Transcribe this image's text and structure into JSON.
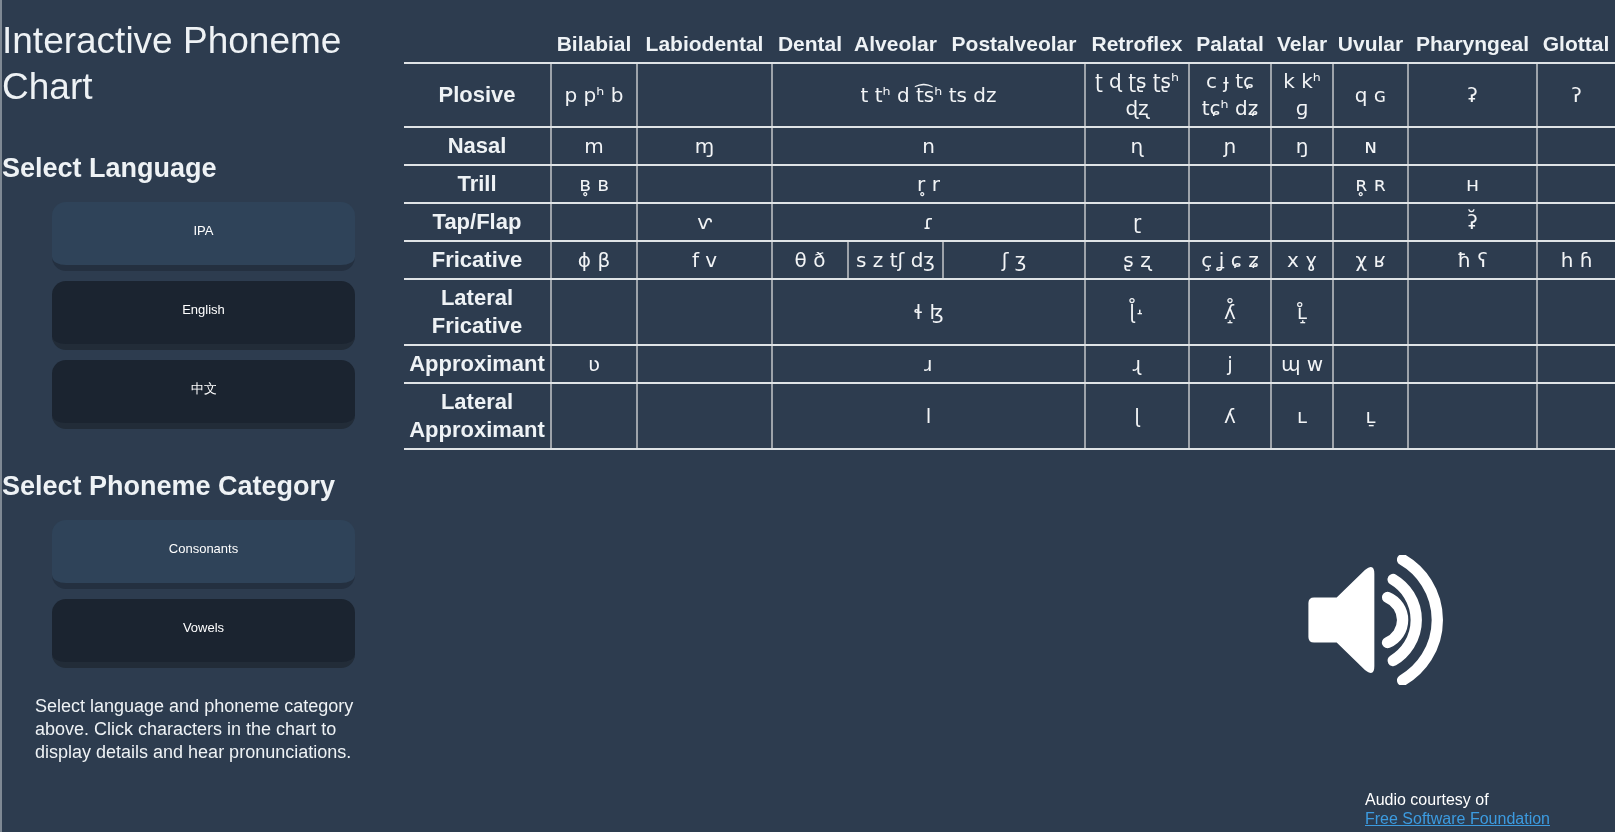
{
  "sidebar": {
    "title": "Interactive Phoneme Chart",
    "language_heading": "Select Language",
    "languages": [
      {
        "label": "IPA",
        "selected": true
      },
      {
        "label": "English",
        "selected": false
      },
      {
        "label": "中文",
        "selected": false
      }
    ],
    "category_heading": "Select Phoneme Category",
    "categories": [
      {
        "label": "Consonants",
        "selected": true
      },
      {
        "label": "Vowels",
        "selected": false
      }
    ],
    "instructions": "Select language and phoneme category above. Click characters in the chart to display details and hear pronunciations."
  },
  "chart": {
    "columns": [
      "Bilabial",
      "Labiodental",
      "Dental",
      "Alveolar",
      "Postalveolar",
      "Retroflex",
      "Palatal",
      "Velar",
      "Uvular",
      "Pharyngeal",
      "Glottal"
    ],
    "rows": [
      {
        "label": "Plosive",
        "cells": [
          {
            "text": "p pʰ b"
          },
          {
            "text": ""
          },
          {
            "text": "t tʰ d t͡sʰ ts dz",
            "colspan": 3
          },
          {
            "text": "ʈ ɖ ʈʂ ʈʂʰ ɖʐ"
          },
          {
            "text": "c ɟ tɕ tɕʰ dʑ"
          },
          {
            "text": "k kʰ ɡ"
          },
          {
            "text": "q ɢ"
          },
          {
            "text": "ʡ"
          },
          {
            "text": "ʔ"
          }
        ]
      },
      {
        "label": "Nasal",
        "cells": [
          {
            "text": "m"
          },
          {
            "text": "ɱ"
          },
          {
            "text": "n",
            "colspan": 3
          },
          {
            "text": "ɳ"
          },
          {
            "text": "ɲ"
          },
          {
            "text": "ŋ"
          },
          {
            "text": "ɴ"
          },
          {
            "text": ""
          },
          {
            "text": ""
          }
        ]
      },
      {
        "label": "Trill",
        "cells": [
          {
            "text": "ʙ̥ ʙ"
          },
          {
            "text": ""
          },
          {
            "text": "r̥ r",
            "colspan": 3
          },
          {
            "text": ""
          },
          {
            "text": ""
          },
          {
            "text": ""
          },
          {
            "text": "ʀ̥ ʀ"
          },
          {
            "text": "ʜ"
          },
          {
            "text": ""
          }
        ]
      },
      {
        "label": "Tap/Flap",
        "cells": [
          {
            "text": ""
          },
          {
            "text": "ⱱ"
          },
          {
            "text": "ɾ",
            "colspan": 3
          },
          {
            "text": "ɽ"
          },
          {
            "text": ""
          },
          {
            "text": ""
          },
          {
            "text": ""
          },
          {
            "text": "ʡ̆"
          },
          {
            "text": ""
          }
        ]
      },
      {
        "label": "Fricative",
        "cells": [
          {
            "text": "ɸ β"
          },
          {
            "text": "f v"
          },
          {
            "text": "θ ð"
          },
          {
            "text": "s z tʃ dʒ"
          },
          {
            "text": "ʃ ʒ"
          },
          {
            "text": "ʂ ʐ"
          },
          {
            "text": "ç ʝ ɕ ʑ"
          },
          {
            "text": "x ɣ"
          },
          {
            "text": "χ ʁ"
          },
          {
            "text": "ħ ʕ"
          },
          {
            "text": "h ɦ"
          }
        ]
      },
      {
        "label": "Lateral Fricative",
        "cells": [
          {
            "text": ""
          },
          {
            "text": ""
          },
          {
            "text": "ɬ ɮ",
            "colspan": 3
          },
          {
            "text": "ɭ̊˔"
          },
          {
            "text": "ʎ̝̊"
          },
          {
            "text": "ʟ̝̊"
          },
          {
            "text": ""
          },
          {
            "text": ""
          },
          {
            "text": ""
          }
        ]
      },
      {
        "label": "Approximant",
        "cells": [
          {
            "text": "ʋ"
          },
          {
            "text": ""
          },
          {
            "text": "ɹ",
            "colspan": 3
          },
          {
            "text": "ɻ"
          },
          {
            "text": "j"
          },
          {
            "text": "ɰ w"
          },
          {
            "text": ""
          },
          {
            "text": ""
          },
          {
            "text": ""
          }
        ]
      },
      {
        "label": "Lateral Approximant",
        "cells": [
          {
            "text": ""
          },
          {
            "text": ""
          },
          {
            "text": "l",
            "colspan": 3
          },
          {
            "text": "ɭ"
          },
          {
            "text": "ʎ"
          },
          {
            "text": "ʟ"
          },
          {
            "text": "ʟ̠"
          },
          {
            "text": ""
          },
          {
            "text": ""
          }
        ]
      }
    ]
  },
  "audio_credit": {
    "text": "Audio courtesy of",
    "link": "Free Software Foundation"
  }
}
